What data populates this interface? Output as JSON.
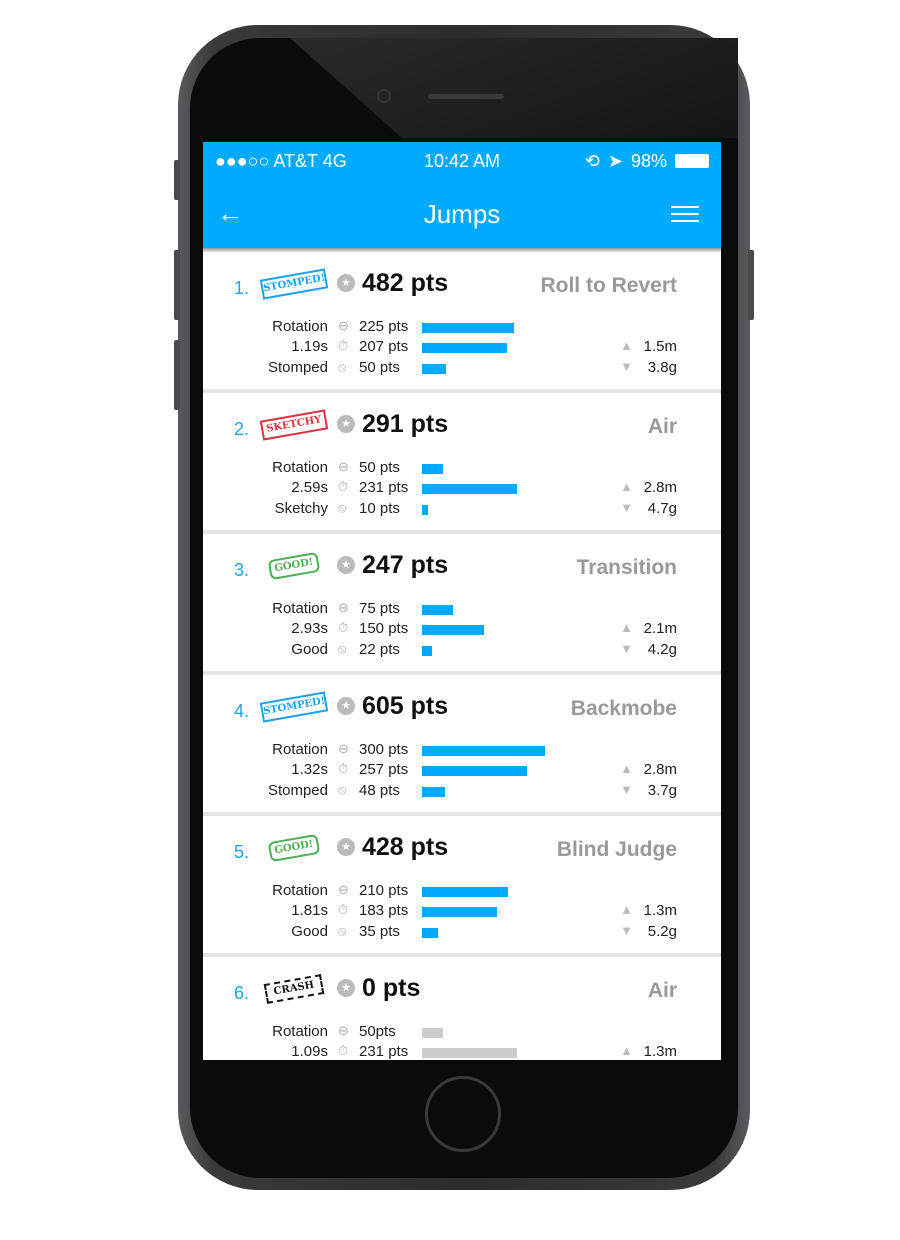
{
  "status_bar": {
    "carrier": "●●●○○ AT&T  4G",
    "time": "10:42 AM",
    "battery": "98%",
    "icons": [
      "rotation-lock-icon",
      "location-arrow-icon",
      "battery-icon"
    ]
  },
  "header": {
    "title": "Jumps",
    "back_icon": "arrow-left-icon",
    "menu_icon": "sliders-icon"
  },
  "colors": {
    "accent": "#00aaff",
    "inactive_bar": "#cccccc"
  },
  "jumps": [
    {
      "index": "1.",
      "stamp": "STOMPED!",
      "stamp_type": "stomped",
      "points": "482 pts",
      "trick": "Roll to Revert",
      "rotation_label": "Rotation",
      "rotation_pts": "225 pts",
      "rotation_value": 225,
      "airtime": "1.19s",
      "airtime_pts": "207 pts",
      "airtime_value": 207,
      "landing": "Stomped",
      "landing_pts": "50 pts",
      "landing_value": 50,
      "height": "1.5m",
      "gforce": "3.8g"
    },
    {
      "index": "2.",
      "stamp": "SKETCHY",
      "stamp_type": "sketchy",
      "points": "291 pts",
      "trick": "Air",
      "rotation_label": "Rotation",
      "rotation_pts": "50 pts",
      "rotation_value": 50,
      "airtime": "2.59s",
      "airtime_pts": "231 pts",
      "airtime_value": 231,
      "landing": "Sketchy",
      "landing_pts": "10 pts",
      "landing_value": 10,
      "height": "2.8m",
      "gforce": "4.7g"
    },
    {
      "index": "3.",
      "stamp": "GOOD!",
      "stamp_type": "good",
      "points": "247 pts",
      "trick": "Transition",
      "rotation_label": "Rotation",
      "rotation_pts": "75 pts",
      "rotation_value": 75,
      "airtime": "2.93s",
      "airtime_pts": "150 pts",
      "airtime_value": 150,
      "landing": "Good",
      "landing_pts": "22 pts",
      "landing_value": 22,
      "height": "2.1m",
      "gforce": "4.2g"
    },
    {
      "index": "4.",
      "stamp": "STOMPED!",
      "stamp_type": "stomped",
      "points": "605 pts",
      "trick": "Backmobe",
      "rotation_label": "Rotation",
      "rotation_pts": "300 pts",
      "rotation_value": 300,
      "airtime": "1.32s",
      "airtime_pts": "257 pts",
      "airtime_value": 257,
      "landing": "Stomped",
      "landing_pts": "48 pts",
      "landing_value": 48,
      "height": "2.8m",
      "gforce": "3.7g"
    },
    {
      "index": "5.",
      "stamp": "GOOD!",
      "stamp_type": "good",
      "points": "428 pts",
      "trick": "Blind Judge",
      "rotation_label": "Rotation",
      "rotation_pts": "210 pts",
      "rotation_value": 210,
      "airtime": "1.81s",
      "airtime_pts": "183 pts",
      "airtime_value": 183,
      "landing": "Good",
      "landing_pts": "35 pts",
      "landing_value": 35,
      "height": "1.3m",
      "gforce": "5.2g"
    },
    {
      "index": "6.",
      "stamp": "CRASH",
      "stamp_type": "crash",
      "points": "0 pts",
      "trick": "Air",
      "rotation_label": "Rotation",
      "rotation_pts": "50pts",
      "rotation_value": 50,
      "airtime": "1.09s",
      "airtime_pts": "231 pts",
      "airtime_value": 231,
      "landing": "",
      "landing_pts": "",
      "landing_value": 0,
      "height": "1.3m",
      "gforce": "",
      "inactive": true
    }
  ]
}
